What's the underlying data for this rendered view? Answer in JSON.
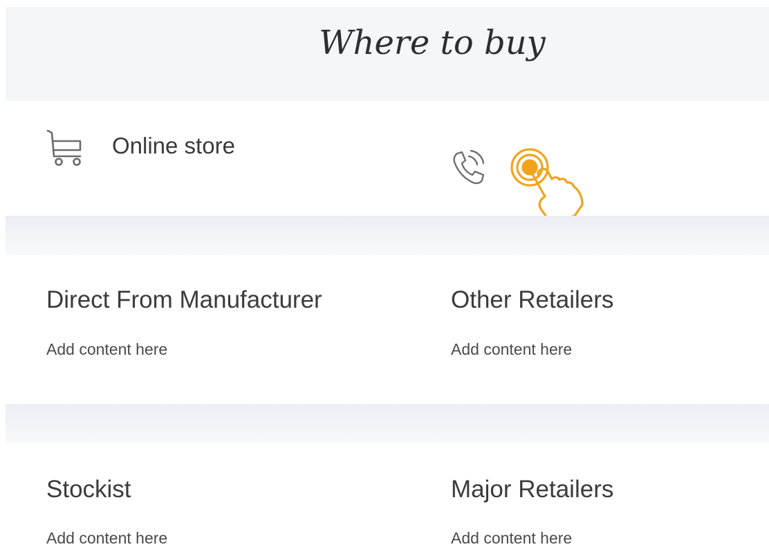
{
  "header": {
    "title": "Where to buy"
  },
  "top_row": {
    "online_store_label": "Online store",
    "cart_icon": "shopping-cart-icon",
    "phone_icon": "phone-ringing-icon",
    "tap_icon": "tap-hand-icon",
    "accent_color": "#f2a31b"
  },
  "sections": [
    {
      "title": "Direct From Manufacturer",
      "body": "Add content here"
    },
    {
      "title": "Other Retailers",
      "body": "Add content here"
    },
    {
      "title": "Stockist",
      "body": "Add content here"
    },
    {
      "title": "Major Retailers",
      "body": "Add content here"
    }
  ]
}
